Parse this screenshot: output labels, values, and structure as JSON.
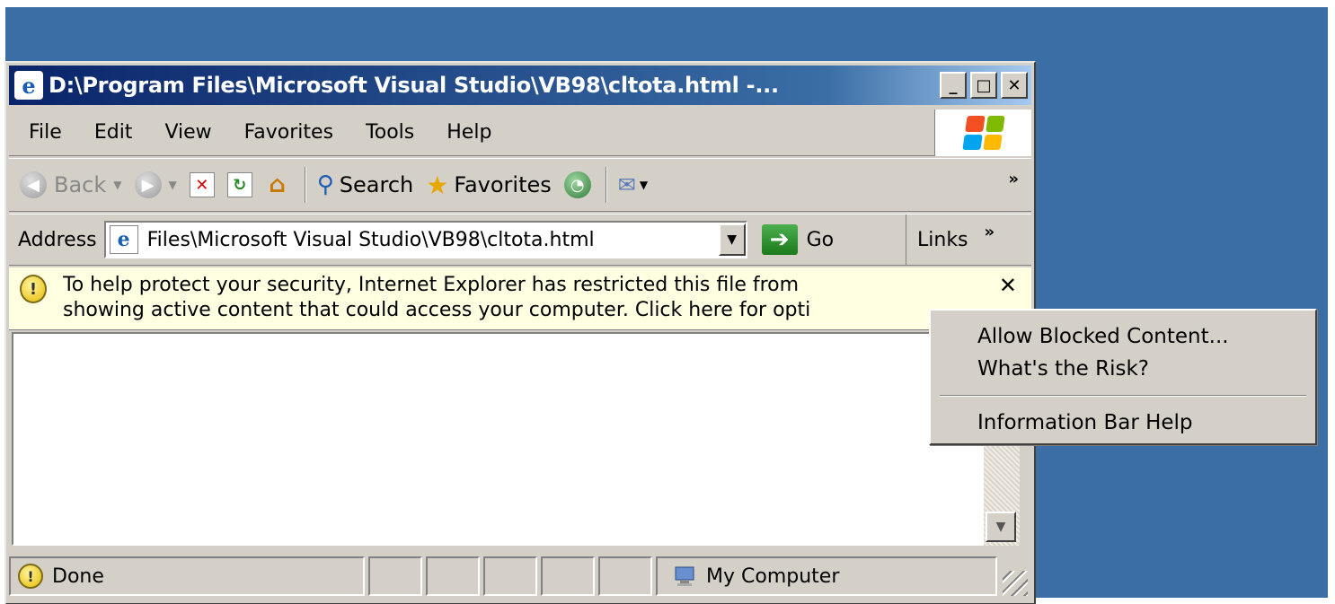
{
  "window": {
    "title": "D:\\Program Files\\Microsoft Visual Studio\\VB98\\cltota.html -...",
    "minimize": "_",
    "maximize": "□",
    "close": "✕"
  },
  "menu": {
    "items": [
      "File",
      "Edit",
      "View",
      "Favorites",
      "Tools",
      "Help"
    ]
  },
  "toolbar": {
    "back_label": "Back",
    "search_label": "Search",
    "favorites_label": "Favorites",
    "more": "»"
  },
  "address": {
    "label": "Address",
    "value": "Files\\Microsoft Visual Studio\\VB98\\cltota.html",
    "go_label": "Go",
    "links_label": "Links",
    "links_more": "»"
  },
  "infobar": {
    "line1": "To help protect your security, Internet Explorer has restricted this file from",
    "line2": "showing active content that could access your computer. Click here for opti",
    "close": "✕"
  },
  "context_menu": {
    "items": [
      "Allow Blocked Content...",
      "What's the Risk?",
      "Information Bar Help"
    ]
  },
  "status": {
    "text": "Done",
    "zone": "My Computer"
  },
  "colors": {
    "desktop": "#3a6ea5",
    "chrome": "#d4d0c8",
    "infobar": "#ffffe1",
    "title_start": "#0a246a"
  }
}
